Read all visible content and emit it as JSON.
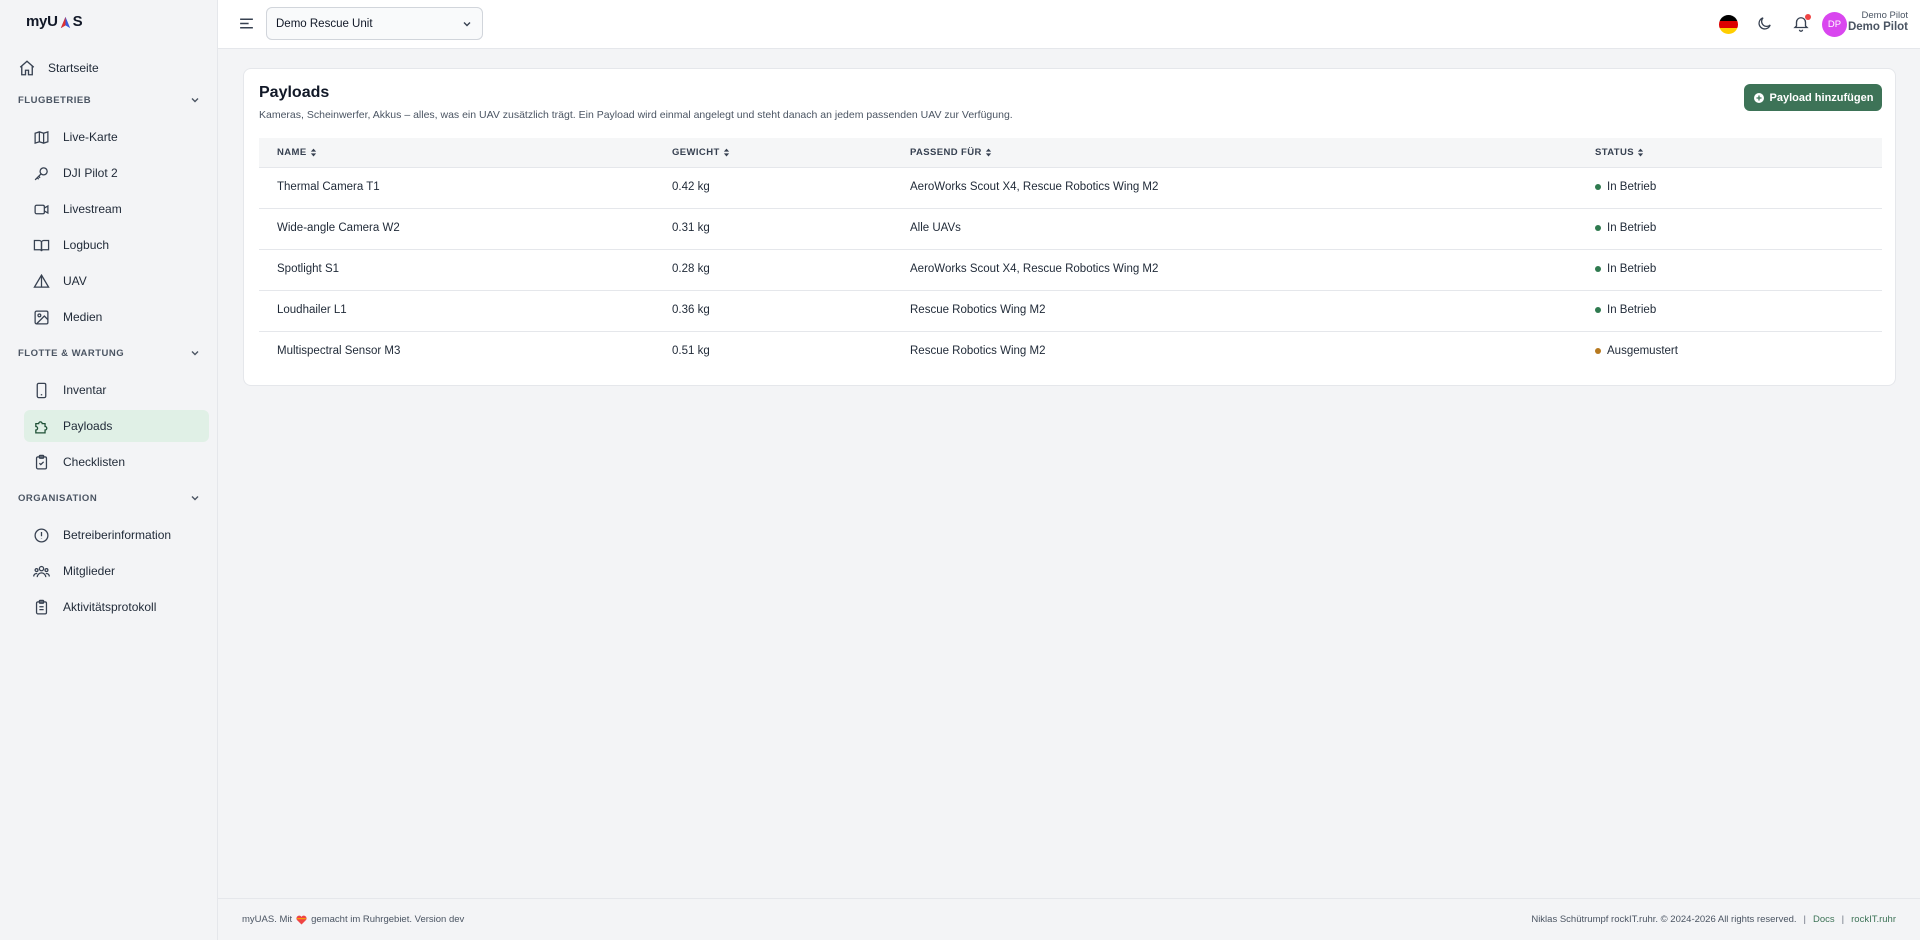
{
  "app": {
    "logo_text_a": "myU",
    "logo_text_b": "S"
  },
  "sidebar": {
    "home": "Startseite",
    "sections": [
      {
        "label": "FLUGBETRIEB",
        "items": [
          "Live-Karte",
          "DJI Pilot 2",
          "Livestream",
          "Logbuch",
          "UAV",
          "Medien"
        ]
      },
      {
        "label": "FLOTTE & WARTUNG",
        "items": [
          "Inventar",
          "Payloads",
          "Checklisten"
        ]
      },
      {
        "label": "ORGANISATION",
        "items": [
          "Betreiberinformation",
          "Mitglieder",
          "Aktivitätsprotokoll"
        ]
      }
    ],
    "active_item": "Payloads"
  },
  "topbar": {
    "unit_select_value": "Demo Rescue Unit",
    "avatar_initials": "DP",
    "user_top": "Demo Pilot",
    "user_name": "Demo Pilot"
  },
  "page": {
    "title": "Payloads",
    "subtitle": "Kameras, Scheinwerfer, Akkus – alles, was ein UAV zusätzlich trägt. Ein Payload wird einmal angelegt und steht danach an jedem passenden UAV zur Verfügung.",
    "add_button": "Payload hinzufügen"
  },
  "table": {
    "columns": [
      "NAME",
      "GEWICHT",
      "PASSEND FÜR",
      "STATUS"
    ],
    "rows": [
      {
        "name": "Thermal Camera T1",
        "weight": "0.42 kg",
        "fits": "AeroWorks Scout X4, Rescue Robotics Wing M2",
        "status": "In Betrieb",
        "status_color": "#2f7a4f"
      },
      {
        "name": "Wide-angle Camera W2",
        "weight": "0.31 kg",
        "fits": "Alle UAVs",
        "status": "In Betrieb",
        "status_color": "#2f7a4f"
      },
      {
        "name": "Spotlight S1",
        "weight": "0.28 kg",
        "fits": "AeroWorks Scout X4, Rescue Robotics Wing M2",
        "status": "In Betrieb",
        "status_color": "#2f7a4f"
      },
      {
        "name": "Loudhailer L1",
        "weight": "0.36 kg",
        "fits": "Rescue Robotics Wing M2",
        "status": "In Betrieb",
        "status_color": "#2f7a4f"
      },
      {
        "name": "Multispectral Sensor M3",
        "weight": "0.51 kg",
        "fits": "Rescue Robotics Wing M2",
        "status": "Ausgemustert",
        "status_color": "#b7791f"
      }
    ]
  },
  "footer": {
    "left_a": "myUAS. Mit",
    "left_b": "gemacht im Ruhrgebiet. Version dev",
    "right_text": "Niklas Schütrumpf rockIT.ruhr. © 2024-2026 All rights reserved.",
    "docs_link": "Docs",
    "rockit_link": "rockIT.ruhr",
    "separator": "|"
  },
  "colors": {
    "accent": "#3d7357",
    "active_bg": "#e0f0e6",
    "avatar": "#d946ef"
  }
}
